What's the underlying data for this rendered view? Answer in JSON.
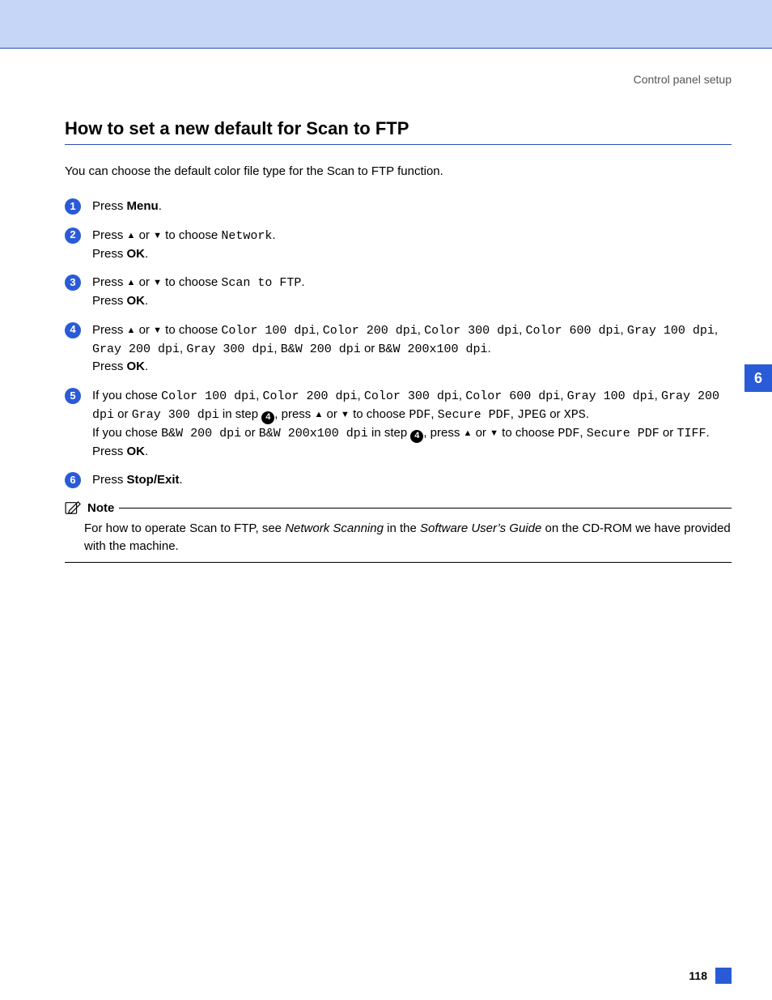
{
  "context": "Control panel setup",
  "title": "How to set a new default for Scan to FTP",
  "intro": "You can choose the default color file type for the Scan to FTP function.",
  "labels": {
    "press": "Press ",
    "or": " or ",
    "or_word": " or ",
    "to_choose": " to choose ",
    "in_step": " in step ",
    "press_comma": ", press ",
    "press_ok": "Press ",
    "ok": "OK",
    "menu": "Menu",
    "stop_exit": "Stop/Exit",
    "if_you_chose": "If you chose "
  },
  "opts": {
    "network": "Network",
    "scan_to_ftp": "Scan to FTP",
    "c100": "Color 100 dpi",
    "c200": "Color 200 dpi",
    "c300": "Color 300 dpi",
    "c600": "Color 600 dpi",
    "g100": "Gray 100 dpi",
    "g200": "Gray 200 dpi",
    "g300": "Gray 300 dpi",
    "bw200": "B&W 200 dpi",
    "bw200x100": "B&W 200x100 dpi",
    "pdf": "PDF",
    "secure_pdf": "Secure PDF",
    "jpeg": "JPEG",
    "xps": "XPS",
    "tiff": "TIFF"
  },
  "steps": {
    "n1": "1",
    "n2": "2",
    "n3": "3",
    "n4": "4",
    "n5": "5",
    "n6": "6",
    "ref4a": "4",
    "ref4b": "4"
  },
  "note": {
    "label": "Note",
    "t1": "For how to operate Scan to FTP, see ",
    "t2": "Network Scanning",
    "t3": " in the ",
    "t4": "Software User’s Guide",
    "t5": " on the CD-ROM we have provided with the machine."
  },
  "chapter_tab": "6",
  "page_number": "118",
  "punct": {
    "period": ".",
    "comma": ", "
  }
}
